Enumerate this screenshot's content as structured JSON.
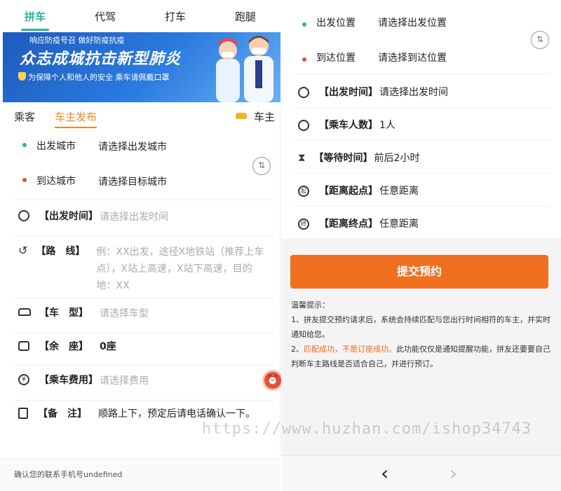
{
  "top_tabs": [
    "拼车",
    "代驾",
    "打车",
    "跑腿"
  ],
  "banner": {
    "small": "响应防疫号召 做好防疫抗疫",
    "title": "众志成城抗击新型肺炎",
    "sub": "为保障个人和他人的安全  乘车请佩戴口罩"
  },
  "subtabs": {
    "passenger": "乘客",
    "driver_post": "车主发布",
    "owner": "车主"
  },
  "left_form": {
    "depart_city_label": "出发城市",
    "depart_city_ph": "请选择出发城市",
    "arrive_city_label": "到达城市",
    "arrive_city_ph": "请选择目标城市",
    "time_label": "【出发时间】",
    "time_ph": "请选择出发时间",
    "route_label": "【路　线】",
    "route_ph": "例：XX出发，途径X地铁站（推荐上车点），X站上高速，X站下高速，目的地：XX",
    "car_label": "【车　型】",
    "car_ph": "请选择车型",
    "seat_label": "【余　座】",
    "seat_val": "0座",
    "fee_label": "【乘车费用】",
    "fee_ph": "请选择费用",
    "note_label": "【备　注】",
    "note_val": "顺路上下，预定后请电话确认一下。"
  },
  "footer": "确认您的联系手机号undefined",
  "right_form": {
    "depart_pos_label": "出发位置",
    "depart_pos_ph": "请选择出发位置",
    "arrive_pos_label": "到达位置",
    "arrive_pos_ph": "请选择到达位置",
    "time_label": "【出发时间】",
    "time_val": "请选择出发时间",
    "people_label": "【乘车人数】",
    "people_val": "1人",
    "wait_label": "【等待时间】",
    "wait_val": "前后2小时",
    "start_label": "【距离起点】",
    "start_val": "任意距离",
    "end_label": "【距离终点】",
    "end_val": "任意距离"
  },
  "submit": "提交预约",
  "tips": {
    "title": "温馨提示：",
    "t1": "1、拼友提交预约请求后，系统会持续匹配与您出行时间相符的车主，并实时通知给您。",
    "t2_prefix": "2、",
    "t2_orange": "匹配成功，不是订座成功。",
    "t2_rest": "此功能仅仅是通知提醒功能，拼友还要要自己判断车主路线是否适合自己，并进行预订。"
  },
  "nav": {
    "back": "‹",
    "forward": "›"
  },
  "watermark": "https://www.huzhan.com/ishop34743",
  "colors": {
    "accent_green": "#26b59a",
    "accent_orange": "#f08a24",
    "submit": "#f07020"
  }
}
